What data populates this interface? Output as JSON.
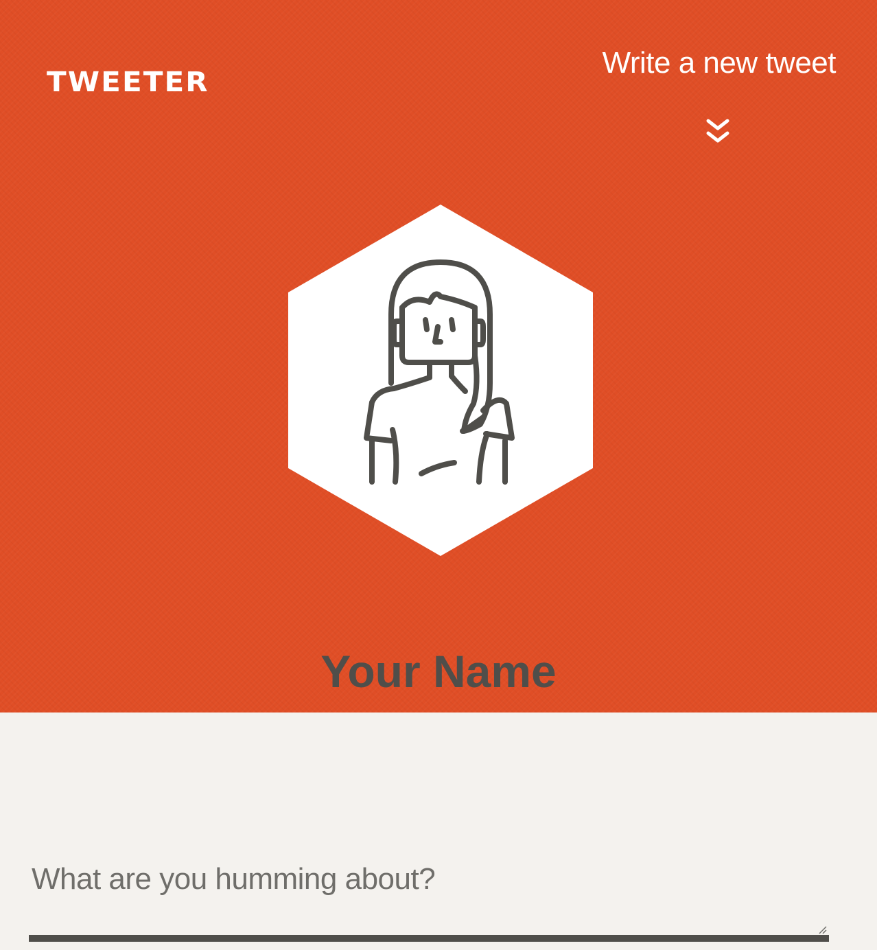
{
  "app": {
    "logo_text": "TWEETER",
    "write_link_label": "Write a new tweet"
  },
  "profile": {
    "name": "Your Name",
    "avatar_icon": "woman-avatar-icon"
  },
  "composer": {
    "placeholder": "What are you humming about?",
    "value": ""
  },
  "colors": {
    "header_bg": "#e04e26",
    "page_bg": "#f4f2ee",
    "text_dark": "#4f4e4a",
    "white": "#ffffff"
  },
  "icons": {
    "expand": "double-chevron-down-icon",
    "resize": "resize-grip-icon"
  }
}
